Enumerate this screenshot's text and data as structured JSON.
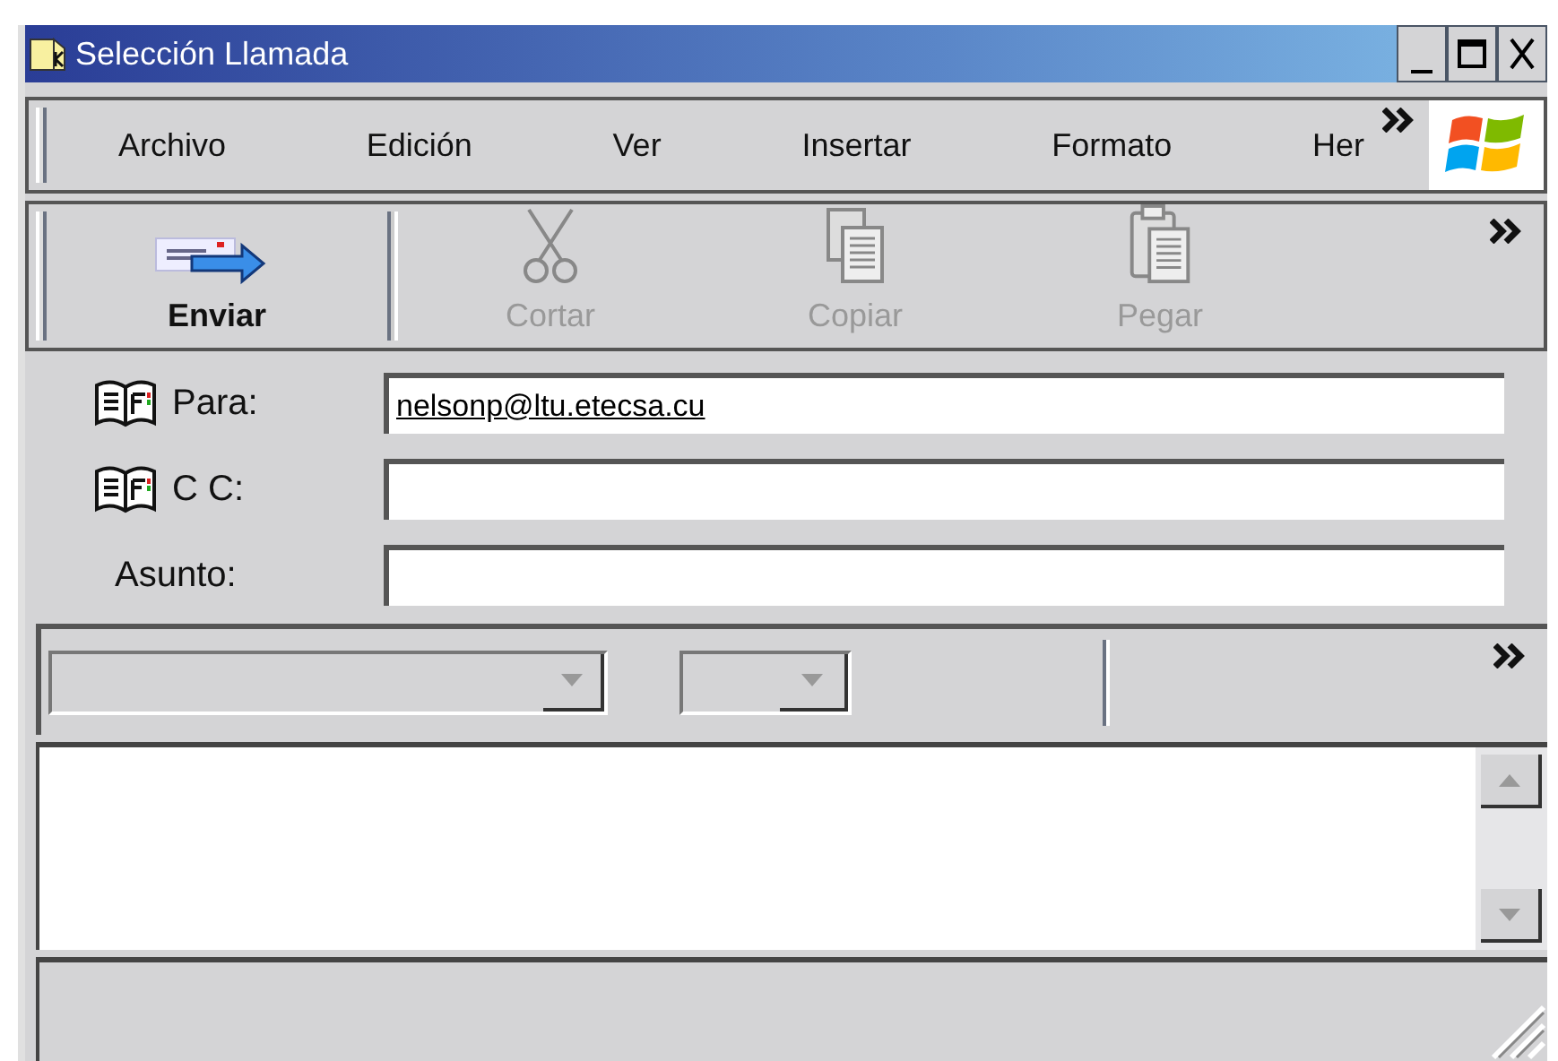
{
  "window": {
    "title": "Selección Llamada"
  },
  "menu": [
    "Archivo",
    "Edición",
    "Ver",
    "Insertar",
    "Formato",
    "Her"
  ],
  "toolbar": [
    {
      "label": "Enviar",
      "kind": "send",
      "disabled": false
    },
    {
      "label": "Cortar",
      "kind": "cut",
      "disabled": true
    },
    {
      "label": "Copiar",
      "kind": "copy",
      "disabled": true
    },
    {
      "label": "Pegar",
      "kind": "paste",
      "disabled": true
    }
  ],
  "fields": [
    {
      "label": "Para:",
      "value": "nelsonp@ltu.etecsa.cu",
      "address_book": true
    },
    {
      "label": "C C:",
      "address_book": true
    },
    {
      "label": "Asunto:",
      "address_book": false
    }
  ]
}
